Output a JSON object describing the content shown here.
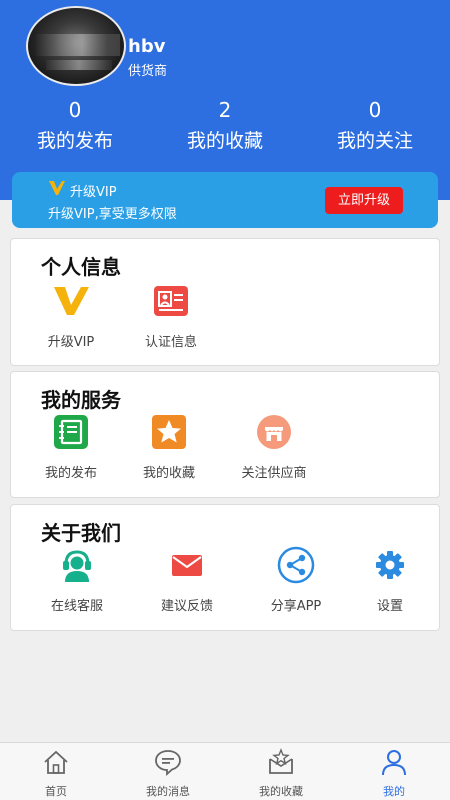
{
  "profile": {
    "username": "hbv",
    "role": "供货商"
  },
  "stats": [
    {
      "value": "0",
      "label": "我的发布"
    },
    {
      "value": "2",
      "label": "我的收藏"
    },
    {
      "value": "0",
      "label": "我的关注"
    }
  ],
  "vip_banner": {
    "title": "升级VIP",
    "subtitle": "升级VIP,享受更多权限",
    "button": "立即升级"
  },
  "sections": {
    "personal": {
      "title": "个人信息",
      "items": [
        "升级VIP",
        "认证信息"
      ]
    },
    "services": {
      "title": "我的服务",
      "items": [
        "我的发布",
        "我的收藏",
        "关注供应商"
      ]
    },
    "about": {
      "title": "关于我们",
      "items": [
        "在线客服",
        "建议反馈",
        "分享APP",
        "设置"
      ]
    }
  },
  "tabbar": {
    "items": [
      "首页",
      "我的消息",
      "我的收藏",
      "我的"
    ],
    "active_index": 3
  },
  "colors": {
    "header": "#2d6fe0",
    "banner": "#2a9fe6",
    "upgrade_button": "#ee1d1d",
    "vip_gold": "#f5b20a"
  }
}
